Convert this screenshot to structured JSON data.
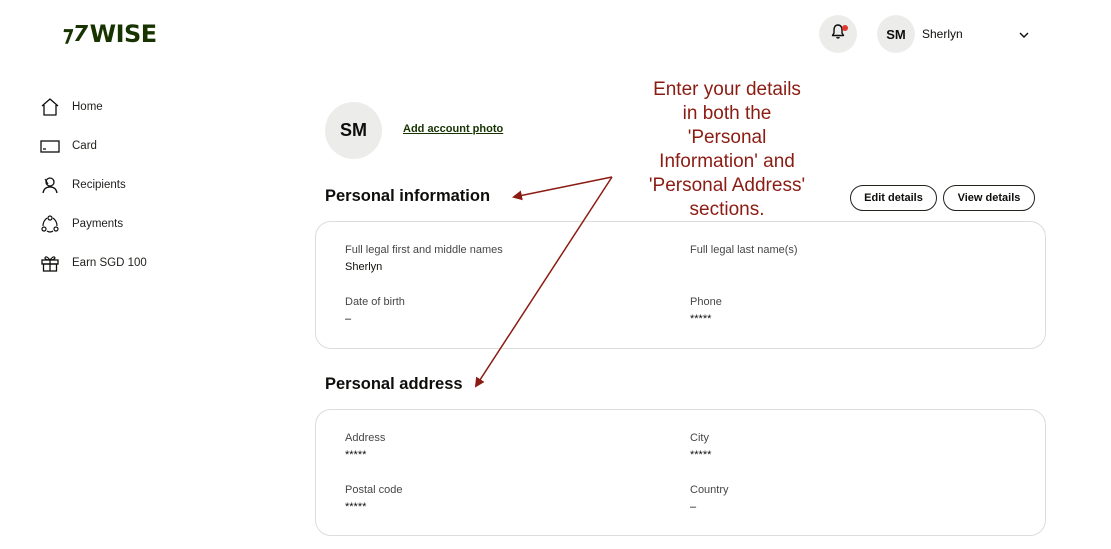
{
  "brand": {
    "name": "WISE",
    "mark": "⁊7"
  },
  "header": {
    "user_initials": "SM",
    "user_name": "Sherlyn",
    "notification_color": "#e0382f"
  },
  "sidebar": {
    "items": [
      {
        "label": "Home",
        "icon": "home-icon"
      },
      {
        "label": "Card",
        "icon": "card-icon"
      },
      {
        "label": "Recipients",
        "icon": "recipients-icon"
      },
      {
        "label": "Payments",
        "icon": "payments-icon"
      },
      {
        "label": "Earn SGD 100",
        "icon": "gift-icon"
      }
    ]
  },
  "profile": {
    "initials": "SM",
    "add_photo_label": "Add account photo"
  },
  "personal_info": {
    "title": "Personal information",
    "edit_label": "Edit details",
    "view_label": "View details",
    "fields": {
      "first_names_label": "Full legal first and middle names",
      "first_names_value": "Sherlyn",
      "last_name_label": "Full legal last name(s)",
      "last_name_value": "",
      "dob_label": "Date of birth",
      "dob_value": "–",
      "phone_label": "Phone",
      "phone_value": "*****"
    }
  },
  "personal_address": {
    "title": "Personal address",
    "fields": {
      "address_label": "Address",
      "address_value": "*****",
      "city_label": "City",
      "city_value": "*****",
      "postal_label": "Postal code",
      "postal_value": "*****",
      "country_label": "Country",
      "country_value": "–"
    }
  },
  "annotation": {
    "lines": [
      "Enter your details",
      "in both the",
      "'Personal",
      "Information' and",
      "'Personal Address'",
      "sections."
    ],
    "color": "#8b1c13"
  }
}
